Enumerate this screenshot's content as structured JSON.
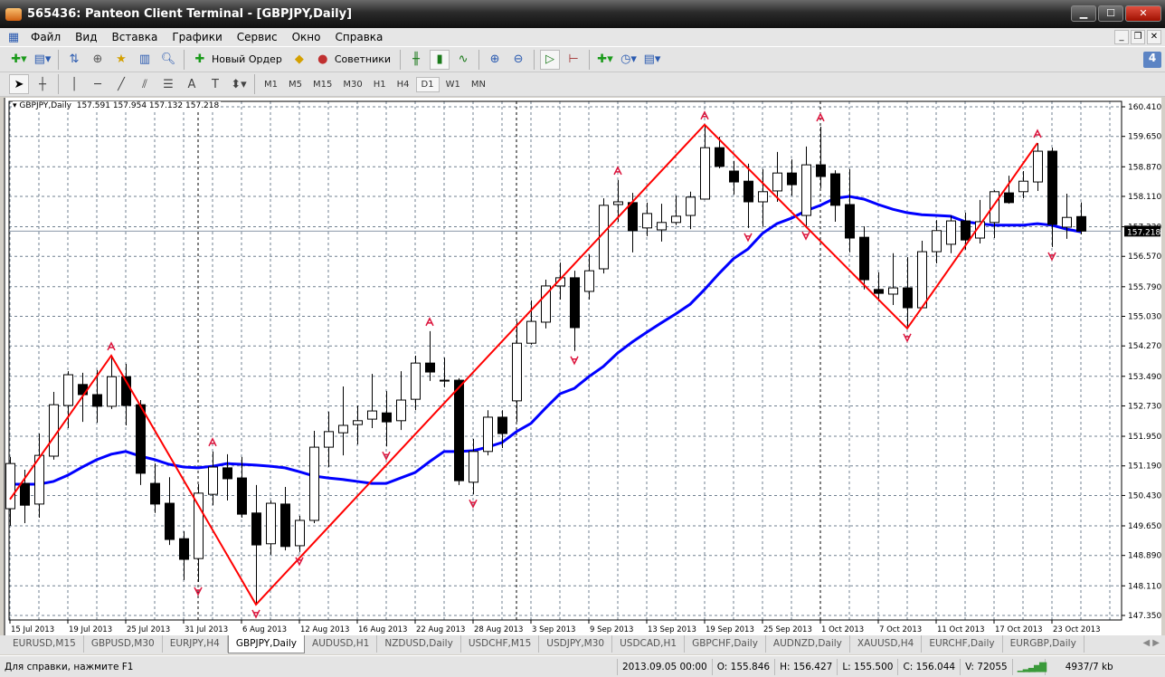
{
  "window": {
    "title": "565436: Panteon Client Terminal - [GBPJPY,Daily]"
  },
  "menu": [
    "Файл",
    "Вид",
    "Вставка",
    "Графики",
    "Сервис",
    "Окно",
    "Справка"
  ],
  "toolbar": {
    "new_order": "Новый Ордер",
    "experts": "Советники",
    "notifications_count": "4"
  },
  "timeframes": [
    "M1",
    "M5",
    "M15",
    "M30",
    "H1",
    "H4",
    "D1",
    "W1",
    "MN"
  ],
  "active_timeframe": "D1",
  "chart_info": {
    "symbol": "GBPJPY,Daily",
    "open": "157.591",
    "high": "157.954",
    "low": "157.132",
    "close": "157.218"
  },
  "chart_data": {
    "type": "candlestick",
    "symbol": "GBPJPY",
    "period": "Daily",
    "ylim": [
      147.35,
      160.41
    ],
    "y_ticks": [
      "160.410",
      "159.650",
      "158.870",
      "158.110",
      "157.330",
      "156.570",
      "155.790",
      "155.030",
      "154.270",
      "153.490",
      "152.730",
      "151.950",
      "151.190",
      "150.430",
      "149.650",
      "148.890",
      "148.110",
      "147.350"
    ],
    "x_labels": [
      "15 Jul 2013",
      "19 Jul 2013",
      "25 Jul 2013",
      "31 Jul 2013",
      "6 Aug 2013",
      "12 Aug 2013",
      "16 Aug 2013",
      "22 Aug 2013",
      "28 Aug 2013",
      "3 Sep 2013",
      "9 Sep 2013",
      "13 Sep 2013",
      "19 Sep 2013",
      "25 Sep 2013",
      "1 Oct 2013",
      "7 Oct 2013",
      "11 Oct 2013",
      "17 Oct 2013",
      "23 Oct 2013"
    ],
    "x_label_every_bars": 4,
    "current_price": "157.218",
    "grid": true,
    "colors": {
      "bull_body": "#ffffff",
      "bear_body": "#000000",
      "ma": "#0000ff",
      "zigzag": "#ff0000",
      "fractal": "#dc143c",
      "grid": "#708090"
    },
    "ohlc": [
      [
        150.09,
        151.42,
        149.65,
        151.25
      ],
      [
        150.74,
        151.09,
        149.72,
        150.18
      ],
      [
        150.21,
        152.02,
        149.86,
        151.46
      ],
      [
        151.44,
        153.09,
        151.35,
        152.76
      ],
      [
        152.74,
        153.62,
        152.16,
        153.53
      ],
      [
        153.28,
        153.58,
        152.32,
        153.02
      ],
      [
        153.02,
        153.65,
        152.3,
        152.72
      ],
      [
        152.72,
        154.02,
        152.65,
        153.48
      ],
      [
        153.48,
        153.81,
        152.23,
        152.74
      ],
      [
        152.76,
        152.88,
        150.7,
        151.0
      ],
      [
        150.74,
        151.25,
        149.98,
        150.21
      ],
      [
        150.23,
        150.9,
        149.16,
        149.3
      ],
      [
        149.32,
        149.51,
        148.26,
        148.79
      ],
      [
        148.81,
        150.72,
        148.21,
        150.49
      ],
      [
        150.46,
        151.56,
        150.18,
        151.16
      ],
      [
        151.14,
        151.49,
        150.3,
        150.86
      ],
      [
        150.88,
        151.42,
        149.86,
        149.95
      ],
      [
        149.98,
        150.7,
        147.63,
        149.16
      ],
      [
        149.19,
        150.3,
        148.91,
        150.23
      ],
      [
        150.21,
        150.65,
        149.02,
        149.12
      ],
      [
        149.14,
        149.91,
        148.98,
        149.79
      ],
      [
        149.79,
        152.09,
        149.72,
        151.67
      ],
      [
        151.67,
        152.58,
        151.16,
        152.07
      ],
      [
        152.04,
        153.23,
        151.46,
        152.23
      ],
      [
        152.25,
        152.74,
        151.74,
        152.35
      ],
      [
        152.39,
        153.55,
        152.16,
        152.6
      ],
      [
        152.55,
        153.11,
        151.69,
        152.32
      ],
      [
        152.35,
        153.62,
        152.11,
        152.88
      ],
      [
        152.9,
        154.02,
        152.62,
        153.83
      ],
      [
        153.83,
        154.65,
        153.37,
        153.6
      ],
      [
        153.39,
        153.97,
        153.21,
        153.39
      ],
      [
        153.39,
        153.44,
        150.7,
        150.81
      ],
      [
        150.77,
        151.88,
        150.46,
        151.56
      ],
      [
        151.56,
        152.62,
        151.46,
        152.44
      ],
      [
        152.44,
        152.62,
        151.65,
        152.02
      ],
      [
        152.86,
        154.9,
        152.32,
        154.34
      ],
      [
        154.34,
        155.44,
        154.3,
        154.9
      ],
      [
        154.88,
        155.97,
        154.72,
        155.81
      ],
      [
        155.81,
        156.41,
        155.46,
        156.02
      ],
      [
        156.02,
        156.2,
        154.14,
        154.74
      ],
      [
        155.67,
        156.62,
        155.46,
        156.2
      ],
      [
        156.25,
        158.06,
        156.13,
        157.88
      ],
      [
        157.9,
        158.53,
        157.46,
        157.97
      ],
      [
        157.95,
        158.2,
        156.67,
        157.23
      ],
      [
        157.3,
        157.95,
        157.09,
        157.67
      ],
      [
        157.25,
        157.92,
        156.95,
        157.44
      ],
      [
        157.44,
        158.13,
        157.37,
        157.6
      ],
      [
        157.62,
        158.23,
        157.27,
        158.09
      ],
      [
        158.04,
        159.95,
        158.04,
        159.36
      ],
      [
        159.36,
        159.64,
        158.83,
        158.88
      ],
      [
        158.76,
        159.02,
        158.16,
        158.48
      ],
      [
        158.5,
        158.95,
        157.3,
        157.97
      ],
      [
        157.97,
        158.81,
        157.34,
        158.23
      ],
      [
        158.25,
        159.25,
        157.97,
        158.71
      ],
      [
        158.71,
        159.06,
        158.13,
        158.41
      ],
      [
        157.62,
        159.39,
        157.34,
        158.92
      ],
      [
        158.92,
        159.9,
        158.32,
        158.62
      ],
      [
        158.69,
        158.78,
        157.46,
        157.88
      ],
      [
        157.9,
        158.81,
        156.67,
        157.04
      ],
      [
        157.06,
        157.34,
        155.72,
        155.97
      ],
      [
        155.72,
        156.16,
        155.41,
        155.62
      ],
      [
        155.6,
        156.65,
        155.32,
        155.76
      ],
      [
        155.76,
        156.55,
        154.72,
        155.25
      ],
      [
        155.25,
        156.97,
        155.25,
        156.69
      ],
      [
        156.69,
        157.5,
        156.39,
        157.23
      ],
      [
        156.88,
        157.62,
        156.65,
        157.48
      ],
      [
        157.48,
        157.69,
        156.74,
        156.99
      ],
      [
        157.04,
        158.02,
        156.9,
        157.46
      ],
      [
        157.44,
        158.27,
        157.04,
        158.23
      ],
      [
        158.2,
        158.64,
        157.92,
        157.95
      ],
      [
        158.23,
        158.76,
        158.06,
        158.5
      ],
      [
        158.48,
        159.48,
        158.25,
        159.27
      ],
      [
        159.27,
        159.36,
        156.81,
        157.39
      ],
      [
        157.32,
        158.18,
        157.02,
        157.57
      ],
      [
        157.591,
        157.954,
        157.132,
        157.218
      ]
    ],
    "ma": [
      150.72,
      150.72,
      150.72,
      150.79,
      150.95,
      151.16,
      151.35,
      151.49,
      151.56,
      151.44,
      151.35,
      151.23,
      151.16,
      151.14,
      151.18,
      151.25,
      151.23,
      151.21,
      151.18,
      151.14,
      151.04,
      150.93,
      150.88,
      150.84,
      150.79,
      150.74,
      150.74,
      150.88,
      151.02,
      151.3,
      151.56,
      151.56,
      151.58,
      151.67,
      151.79,
      152.07,
      152.28,
      152.67,
      153.04,
      153.18,
      153.48,
      153.74,
      154.09,
      154.37,
      154.62,
      154.86,
      155.09,
      155.34,
      155.72,
      156.13,
      156.51,
      156.76,
      157.16,
      157.41,
      157.55,
      157.74,
      157.88,
      158.06,
      158.11,
      158.04,
      157.9,
      157.78,
      157.69,
      157.64,
      157.62,
      157.6,
      157.46,
      157.41,
      157.37,
      157.37,
      157.37,
      157.41,
      157.37,
      157.27,
      157.2
    ],
    "zigzag": [
      [
        0,
        150.33
      ],
      [
        7,
        154.02
      ],
      [
        17,
        147.63
      ],
      [
        48,
        159.95
      ],
      [
        62,
        154.72
      ],
      [
        71,
        159.48
      ]
    ],
    "fractals_up": [
      7,
      14,
      29,
      42,
      48,
      56,
      71
    ],
    "fractals_down": [
      13,
      17,
      20,
      26,
      32,
      39,
      51,
      55,
      62,
      72
    ],
    "period_separators": [
      13,
      35,
      56
    ]
  },
  "tabs": [
    "EURUSD,M15",
    "GBPUSD,M30",
    "EURJPY,H4",
    "GBPJPY,Daily",
    "AUDUSD,H1",
    "NZDUSD,Daily",
    "USDCHF,M15",
    "USDJPY,M30",
    "USDCAD,H1",
    "GBPCHF,Daily",
    "AUDNZD,Daily",
    "XAUUSD,H4",
    "EURCHF,Daily",
    "EURGBP,Daily"
  ],
  "active_tab": "GBPJPY,Daily",
  "status": {
    "help": "Для справки, нажмите F1",
    "datetime": "2013.09.05 00:00",
    "open": "O: 155.846",
    "high": "H: 156.427",
    "low": "L: 155.500",
    "close": "C: 156.044",
    "volume": "V: 72055",
    "traffic": "4937/7 kb"
  }
}
